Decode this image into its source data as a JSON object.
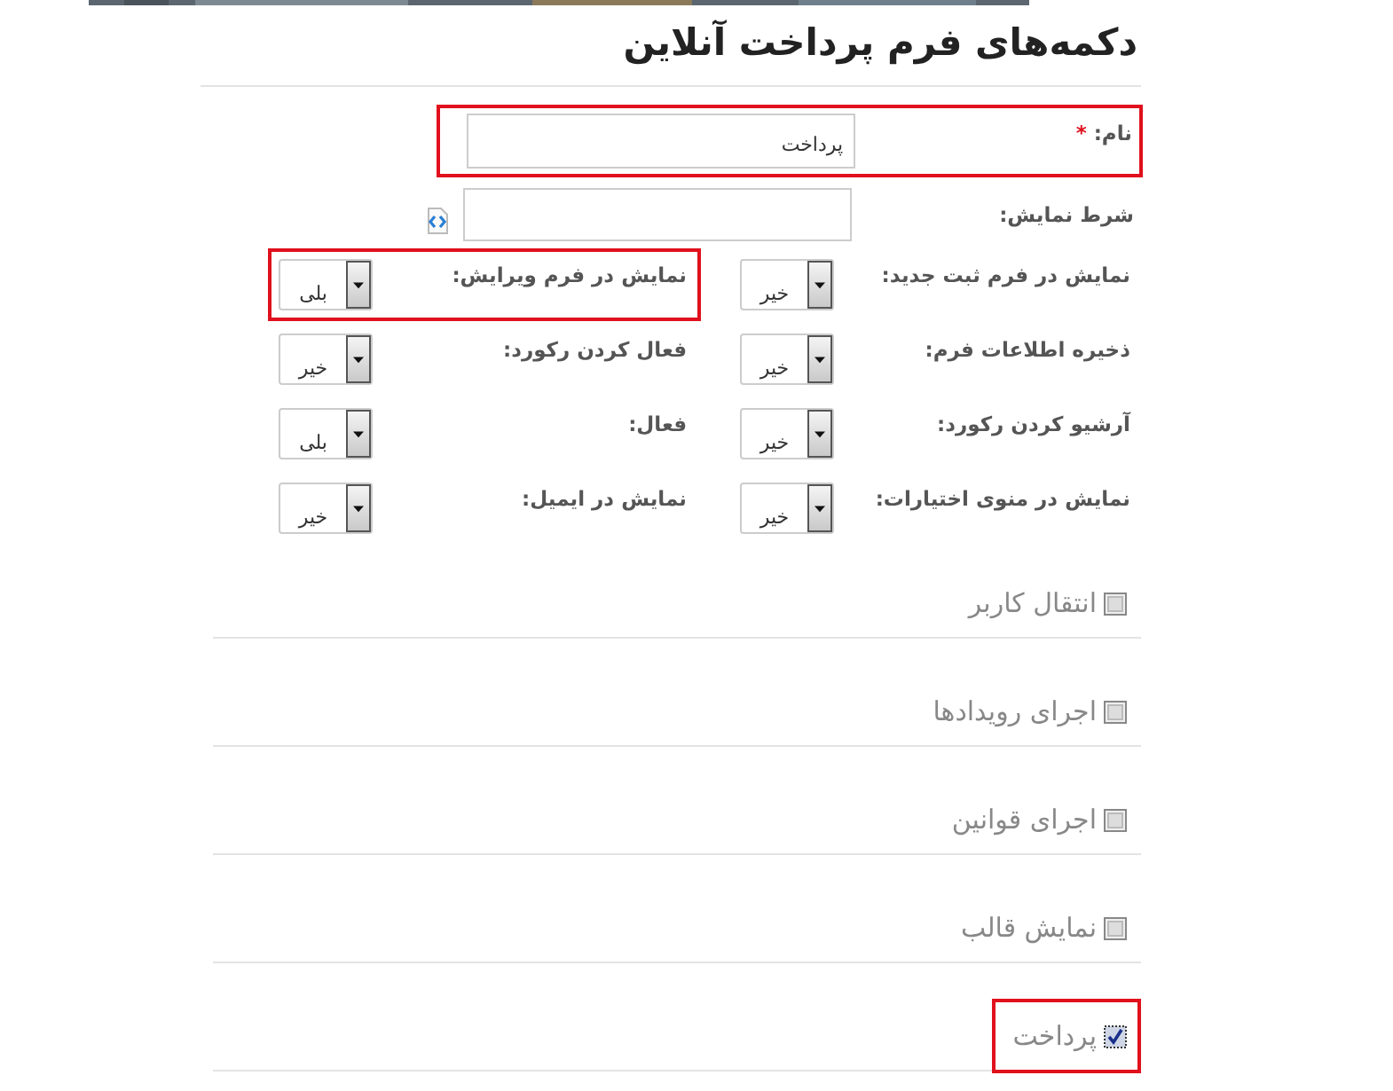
{
  "title": "دکمه‌های فرم پرداخت آنلاین",
  "name_field": {
    "label": "نام:",
    "required_mark": "*",
    "value": "پرداخت",
    "highlighted": true
  },
  "condition_field": {
    "label": "شرط نمایش:"
  },
  "selects": [
    {
      "label": "نمایش در فرم ثبت جدید:",
      "value": "خیر",
      "highlighted": false
    },
    {
      "label": "نمایش در فرم ویرایش:",
      "value": "بلی",
      "highlighted": true
    },
    {
      "label": "ذخیره اطلاعات فرم:",
      "value": "خیر",
      "highlighted": false
    },
    {
      "label": "فعال کردن رکورد:",
      "value": "خیر",
      "highlighted": false
    },
    {
      "label": "آرشیو کردن رکورد:",
      "value": "خیر",
      "highlighted": false
    },
    {
      "label": "فعال:",
      "value": "بلی",
      "highlighted": false
    },
    {
      "label": "نمایش در منوی اختیارات:",
      "value": "خیر",
      "highlighted": false
    },
    {
      "label": "نمایش در ایمیل:",
      "value": "خیر",
      "highlighted": false
    }
  ],
  "checks": [
    {
      "label": "انتقال کاربر",
      "checked": false,
      "highlighted": false
    },
    {
      "label": "اجرای رویدادها",
      "checked": false,
      "highlighted": false
    },
    {
      "label": "اجرای قوانین",
      "checked": false,
      "highlighted": false
    },
    {
      "label": "نمایش قالب",
      "checked": false,
      "highlighted": false
    },
    {
      "label": "پرداخت",
      "checked": true,
      "highlighted": true
    }
  ]
}
